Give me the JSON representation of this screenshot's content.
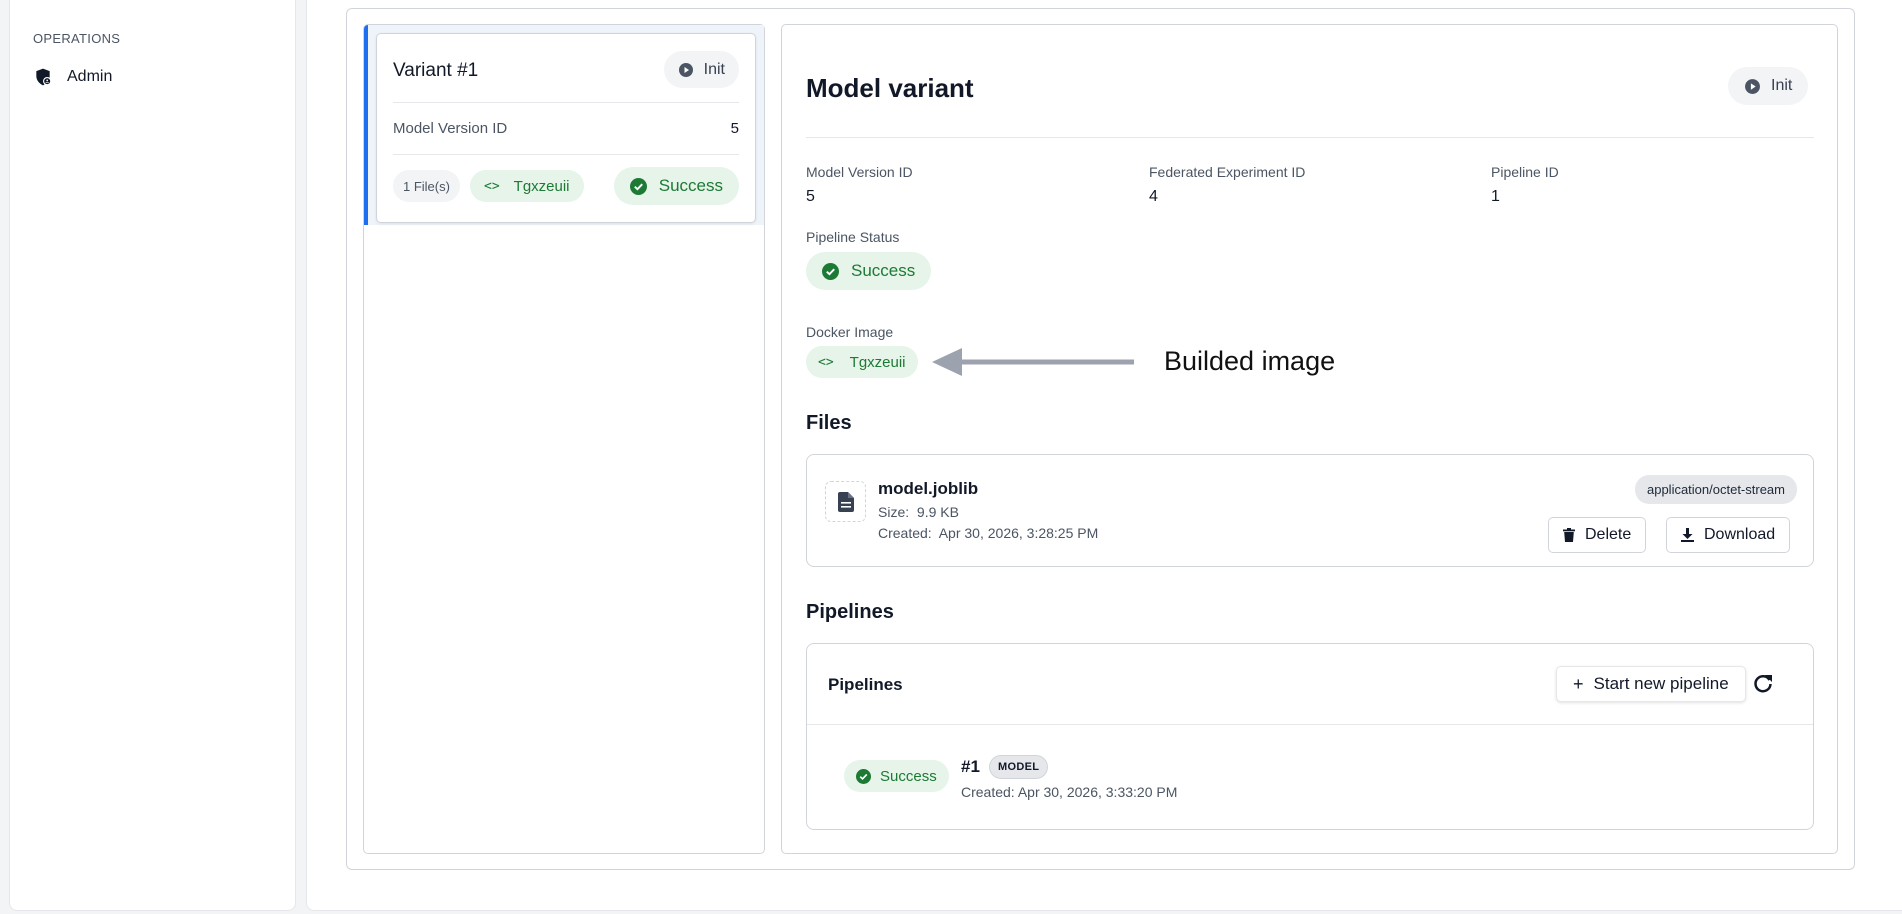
{
  "sidebar": {
    "section_label": "OPERATIONS",
    "items": [
      {
        "label": "Admin",
        "icon": "shield-admin-icon"
      }
    ]
  },
  "variant_card": {
    "title": "Variant #1",
    "status": "Init",
    "model_version_label": "Model Version ID",
    "model_version_value": "5",
    "files_badge": "1 File(s)",
    "docker_image": "Tgxzeuii",
    "pipeline_status": "Success"
  },
  "detail": {
    "title": "Model variant",
    "status": "Init",
    "fields": {
      "model_version_label": "Model Version ID",
      "model_version_value": "5",
      "federated_experiment_label": "Federated Experiment ID",
      "federated_experiment_value": "4",
      "pipeline_id_label": "Pipeline ID",
      "pipeline_id_value": "1",
      "pipeline_status_label": "Pipeline Status",
      "pipeline_status_value": "Success",
      "docker_image_label": "Docker Image",
      "docker_image_value": "Tgxzeuii"
    },
    "annotation": "Builded image",
    "files_title": "Files",
    "file": {
      "name": "model.joblib",
      "size_label": "Size:",
      "size_value": "9.9 KB",
      "created_label": "Created:",
      "created_value": "Apr 30, 2026, 3:28:25 PM",
      "mime": "application/octet-stream",
      "delete_label": "Delete",
      "download_label": "Download"
    },
    "pipelines_title": "Pipelines",
    "pipelines_card": {
      "title": "Pipelines",
      "start_label": "Start new pipeline",
      "rows": [
        {
          "status": "Success",
          "number": "#1",
          "badge": "MODEL",
          "created": "Created: Apr 30, 2026, 3:33:20 PM"
        }
      ]
    }
  },
  "colors": {
    "accent": "#1e6ff0",
    "success_bg": "#e6f4ea",
    "success_text": "#1d7a35"
  }
}
